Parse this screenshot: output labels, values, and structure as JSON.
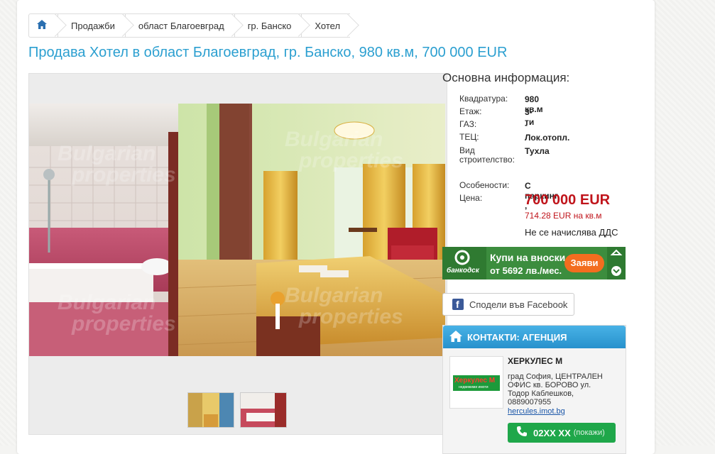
{
  "breadcrumb": {
    "items": [
      "Продажби",
      "област Благоевград",
      "гр. Банско",
      "Хотел"
    ]
  },
  "title": "Продава Хотел в област Благоевград, гр. Банско, 980 кв.м, 700 000 EUR",
  "info": {
    "heading": "Основна информация:",
    "rows": [
      {
        "label": "Квадратура:",
        "value": "980 кв.м"
      },
      {
        "label": "Етаж:",
        "value": "3-ти"
      },
      {
        "label": "ГАЗ:",
        "value": "-"
      },
      {
        "label": "ТЕЦ:",
        "value": "Лок.отопл."
      },
      {
        "label": "Вид строителство:",
        "value": "Тухла"
      },
      {
        "label": "Особености:",
        "value": "С паркинг ,"
      },
      {
        "label": "Цена:",
        "value": ""
      }
    ],
    "price": "700 000 EUR",
    "price_per_sqm": "714.28 EUR на кв.м",
    "vat": "Не се начислява ДДС"
  },
  "banner": {
    "brand": "банкодск",
    "line1": "Купи на вноски",
    "line2": "от 5692 лв./мес.",
    "cta": "Заяви"
  },
  "facebook": {
    "label": "Сподели във Facebook"
  },
  "contact": {
    "header": "КОНТАКТИ: АГЕНЦИЯ",
    "logo_text": "Херкулес М",
    "logo_sub": "недвижими имоти",
    "agency": "ХЕРКУЛЕС М",
    "address": "град София, ЦЕНТРАЛЕН ОФИС кв. БОРОВО ул. Тодор Каблешков,",
    "phone_text": "0889007955",
    "website": "hercules.imot.bg",
    "call_number": "02XX XX",
    "call_show": "(покажи)"
  },
  "watermark": "Bulgarian Properties",
  "colors": {
    "accent": "#2b9fd0",
    "price": "#c0141b",
    "banner": "#3a8b3a",
    "call": "#1fa74a"
  }
}
